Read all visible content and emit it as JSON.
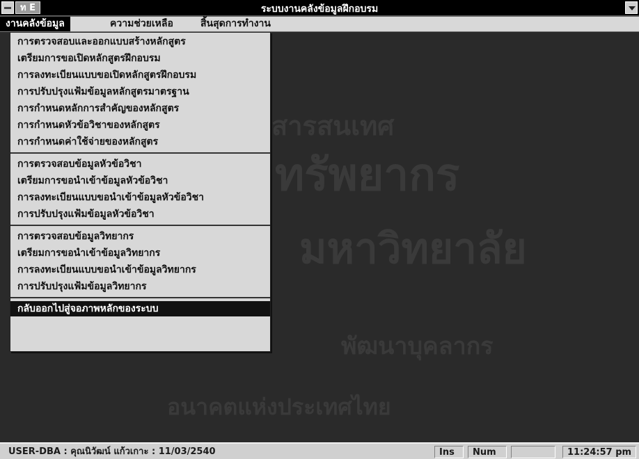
{
  "window": {
    "title": "ระบบงานคลังข้อมูลฝึกอบรม",
    "app_icon_text": "ท E"
  },
  "menubar": {
    "items": [
      {
        "label": "งานคลังข้อมูล",
        "active": true
      },
      {
        "label": "ความช่วยเหลือ",
        "active": false
      },
      {
        "label": "สิ้นสุดการทำงาน",
        "active": false
      }
    ]
  },
  "dropdown": {
    "groups": [
      {
        "items": [
          "การตรวจสอบและออกแบบสร้างหลักสูตร",
          "เตรียมการขอเปิดหลักสูตรฝึกอบรม",
          "การลงทะเบียนแบบขอเปิดหลักสูตรฝึกอบรม",
          "การปรับปรุงแฟ้มข้อมูลหลักสูตรมาตรฐาน",
          "การกำหนดหลักการสำคัญของหลักสูตร",
          "การกำหนดหัวข้อวิชาของหลักสูตร",
          "การกำหนดค่าใช้จ่ายของหลักสูตร"
        ]
      },
      {
        "items": [
          "การตรวจสอบข้อมูลหัวข้อวิชา",
          "เตรียมการขอนำเข้าข้อมูลหัวข้อวิชา",
          "การลงทะเบียนแบบขอนำเข้าข้อมูลหัวข้อวิชา",
          "การปรับปรุงแฟ้มข้อมูลหัวข้อวิชา"
        ]
      },
      {
        "items": [
          "การตรวจสอบข้อมูลวิทยากร",
          "เตรียมการขอนำเข้าข้อมูลวิทยากร",
          "การลงทะเบียนแบบขอนำเข้าข้อมูลวิทยากร",
          "การปรับปรุงแฟ้มข้อมูลวิทยากร"
        ]
      }
    ],
    "exit_item": "กลับออกไปสู่จอภาพหลักของระบบ"
  },
  "watermark": {
    "lines": [
      "สารสนเทศ",
      "ทรัพยากร",
      "มหาวิทยาลัย",
      "พัฒนาบุคลากร",
      "อนาคตแห่งประเทศไทย"
    ]
  },
  "statusbar": {
    "user_info": "USER-DBA  :  คุณนิวัฒน์  แก้วเกาะ  :  11/03/2540",
    "ins": "Ins",
    "num": "Num",
    "blank": "",
    "time": "11:24:57 pm"
  },
  "colors": {
    "background": "#2a2a2a",
    "menu_bg": "#d8d8d8",
    "selection": "#111111"
  }
}
